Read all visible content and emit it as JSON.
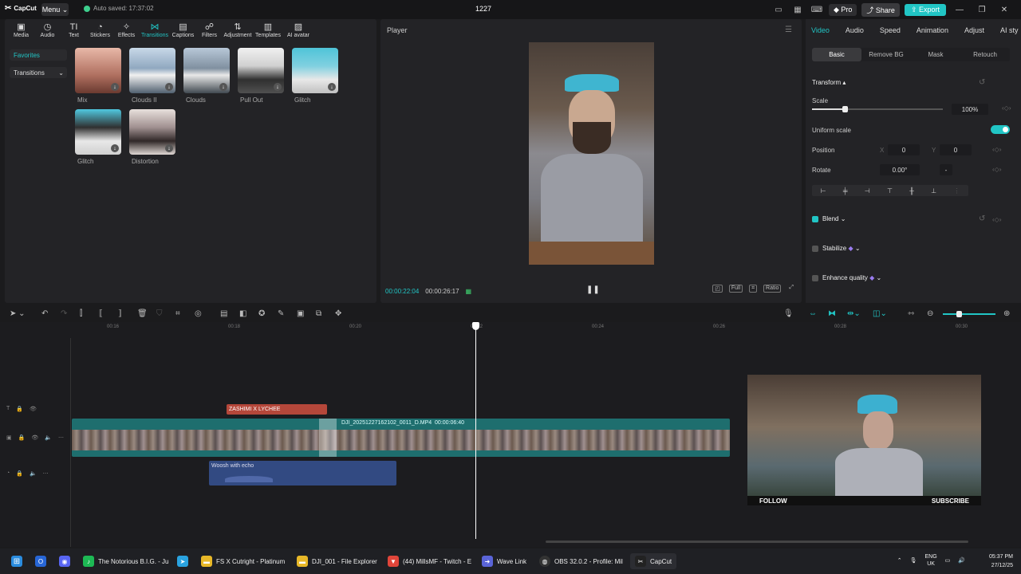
{
  "titlebar": {
    "brand": "CapCut",
    "menu_label": "Menu",
    "autosave": "Auto saved: 17:37:02",
    "project_name": "1227",
    "pro_label": "Pro",
    "share_label": "Share",
    "export_label": "Export"
  },
  "tools": [
    {
      "label": "Media",
      "icon": "▣"
    },
    {
      "label": "Audio",
      "icon": "◷"
    },
    {
      "label": "Text",
      "icon": "TI"
    },
    {
      "label": "Stickers",
      "icon": "◔"
    },
    {
      "label": "Effects",
      "icon": "✧"
    },
    {
      "label": "Transitions",
      "icon": "⋈"
    },
    {
      "label": "Captions",
      "icon": "▤"
    },
    {
      "label": "Filters",
      "icon": "☍"
    },
    {
      "label": "Adjustment",
      "icon": "⇅"
    },
    {
      "label": "Templates",
      "icon": "▥"
    },
    {
      "label": "AI avatar",
      "icon": "▨"
    }
  ],
  "sidebar": {
    "favorites": "Favorites",
    "transitions": "Transitions"
  },
  "transitions_grid": [
    {
      "label": "Mix"
    },
    {
      "label": "Clouds II"
    },
    {
      "label": "Clouds"
    },
    {
      "label": "Pull Out"
    },
    {
      "label": "Glitch"
    },
    {
      "label": "Glitch"
    },
    {
      "label": "Distortion"
    }
  ],
  "player": {
    "title": "Player",
    "current_time": "00:00:22:04",
    "total_time": "00:00:26:17",
    "full_label": "Full",
    "ratio_label": "Ratio"
  },
  "right_panel": {
    "tabs": [
      "Video",
      "Audio",
      "Speed",
      "Animation",
      "Adjust",
      "AI sty"
    ],
    "subtabs": [
      "Basic",
      "Remove BG",
      "Mask",
      "Retouch"
    ],
    "transform": "Transform",
    "scale_label": "Scale",
    "scale_value": "100%",
    "scale_level": 0.25,
    "uniform_scale": "Uniform scale",
    "position_label": "Position",
    "pos_x_label": "X",
    "pos_x": "0",
    "pos_y_label": "Y",
    "pos_y": "0",
    "rotate_label": "Rotate",
    "rotate_value": "0.00°",
    "blend": "Blend",
    "stabilize": "Stabilize",
    "enhance_quality": "Enhance quality"
  },
  "timeline": {
    "ticks": [
      "00:16",
      "00:18",
      "00:20",
      "00:22",
      "00:24",
      "00:26",
      "00:28",
      "00:30"
    ],
    "text_clip": "ZASHIMI X LYCHEE",
    "video_clip": "DJI_20251227162102_0011_D.MP4",
    "video_duration": "00:00:06:40",
    "audio_clip": "Woosh with echo",
    "webcam_left": "FOLLOW",
    "webcam_right": "SUBSCRIBE"
  },
  "taskbar": {
    "apps": [
      {
        "label": "The Notorious B.I.G. - Ju",
        "color": "#1db954"
      },
      {
        "label": "",
        "color": "#2aa3e0"
      },
      {
        "label": "FS X Cutright - Platinum",
        "color": "#e8b828"
      },
      {
        "label": "DJI_001 - File Explorer",
        "color": "#e8b828"
      },
      {
        "label": "(44) MillsMF - Twitch - E",
        "color": "#e0453a"
      },
      {
        "label": "Wave Link",
        "color": "#5a64d8"
      },
      {
        "label": "OBS 32.0.2 - Profile: Mil",
        "color": "#333"
      },
      {
        "label": "CapCut",
        "color": "#222"
      }
    ],
    "lang_top": "ENG",
    "lang_bottom": "UK",
    "time": "05:37 PM",
    "date": "27/12/25"
  }
}
